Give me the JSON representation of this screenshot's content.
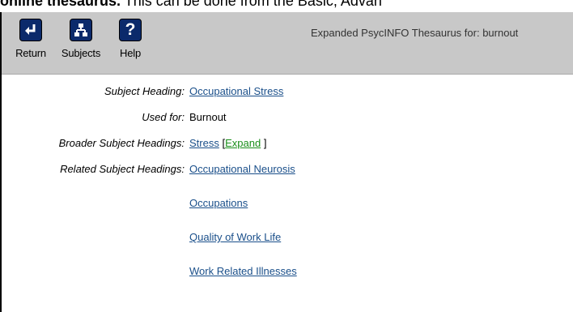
{
  "caption": {
    "bold": "online thesaurus.",
    "text": " This can be done from the Basic, Advan"
  },
  "toolbar": {
    "return_label": "Return",
    "subjects_label": "Subjects",
    "help_label": "Help",
    "help_icon_glyph": "?",
    "title": "Expanded PsycINFO Thesaurus for: burnout"
  },
  "entries": {
    "subject_heading_label": "Subject Heading:",
    "subject_heading_value": "Occupational Stress",
    "used_for_label": "Used for:",
    "used_for_value": "Burnout",
    "broader_label": "Broader Subject Headings:",
    "broader_value": "Stress",
    "expand_open": "[",
    "expand_label": "Expand",
    "expand_close": "]",
    "related_label": "Related Subject Headings:",
    "related": [
      "Occupational Neurosis",
      "Occupations",
      "Quality of Work Life",
      "Work Related Illnesses"
    ]
  },
  "colors": {
    "toolbar_bg": "#c8c8c8",
    "icon_bg": "#0b2a6b",
    "link": "#1a4f8a",
    "expand_link": "#1b8f1b"
  }
}
